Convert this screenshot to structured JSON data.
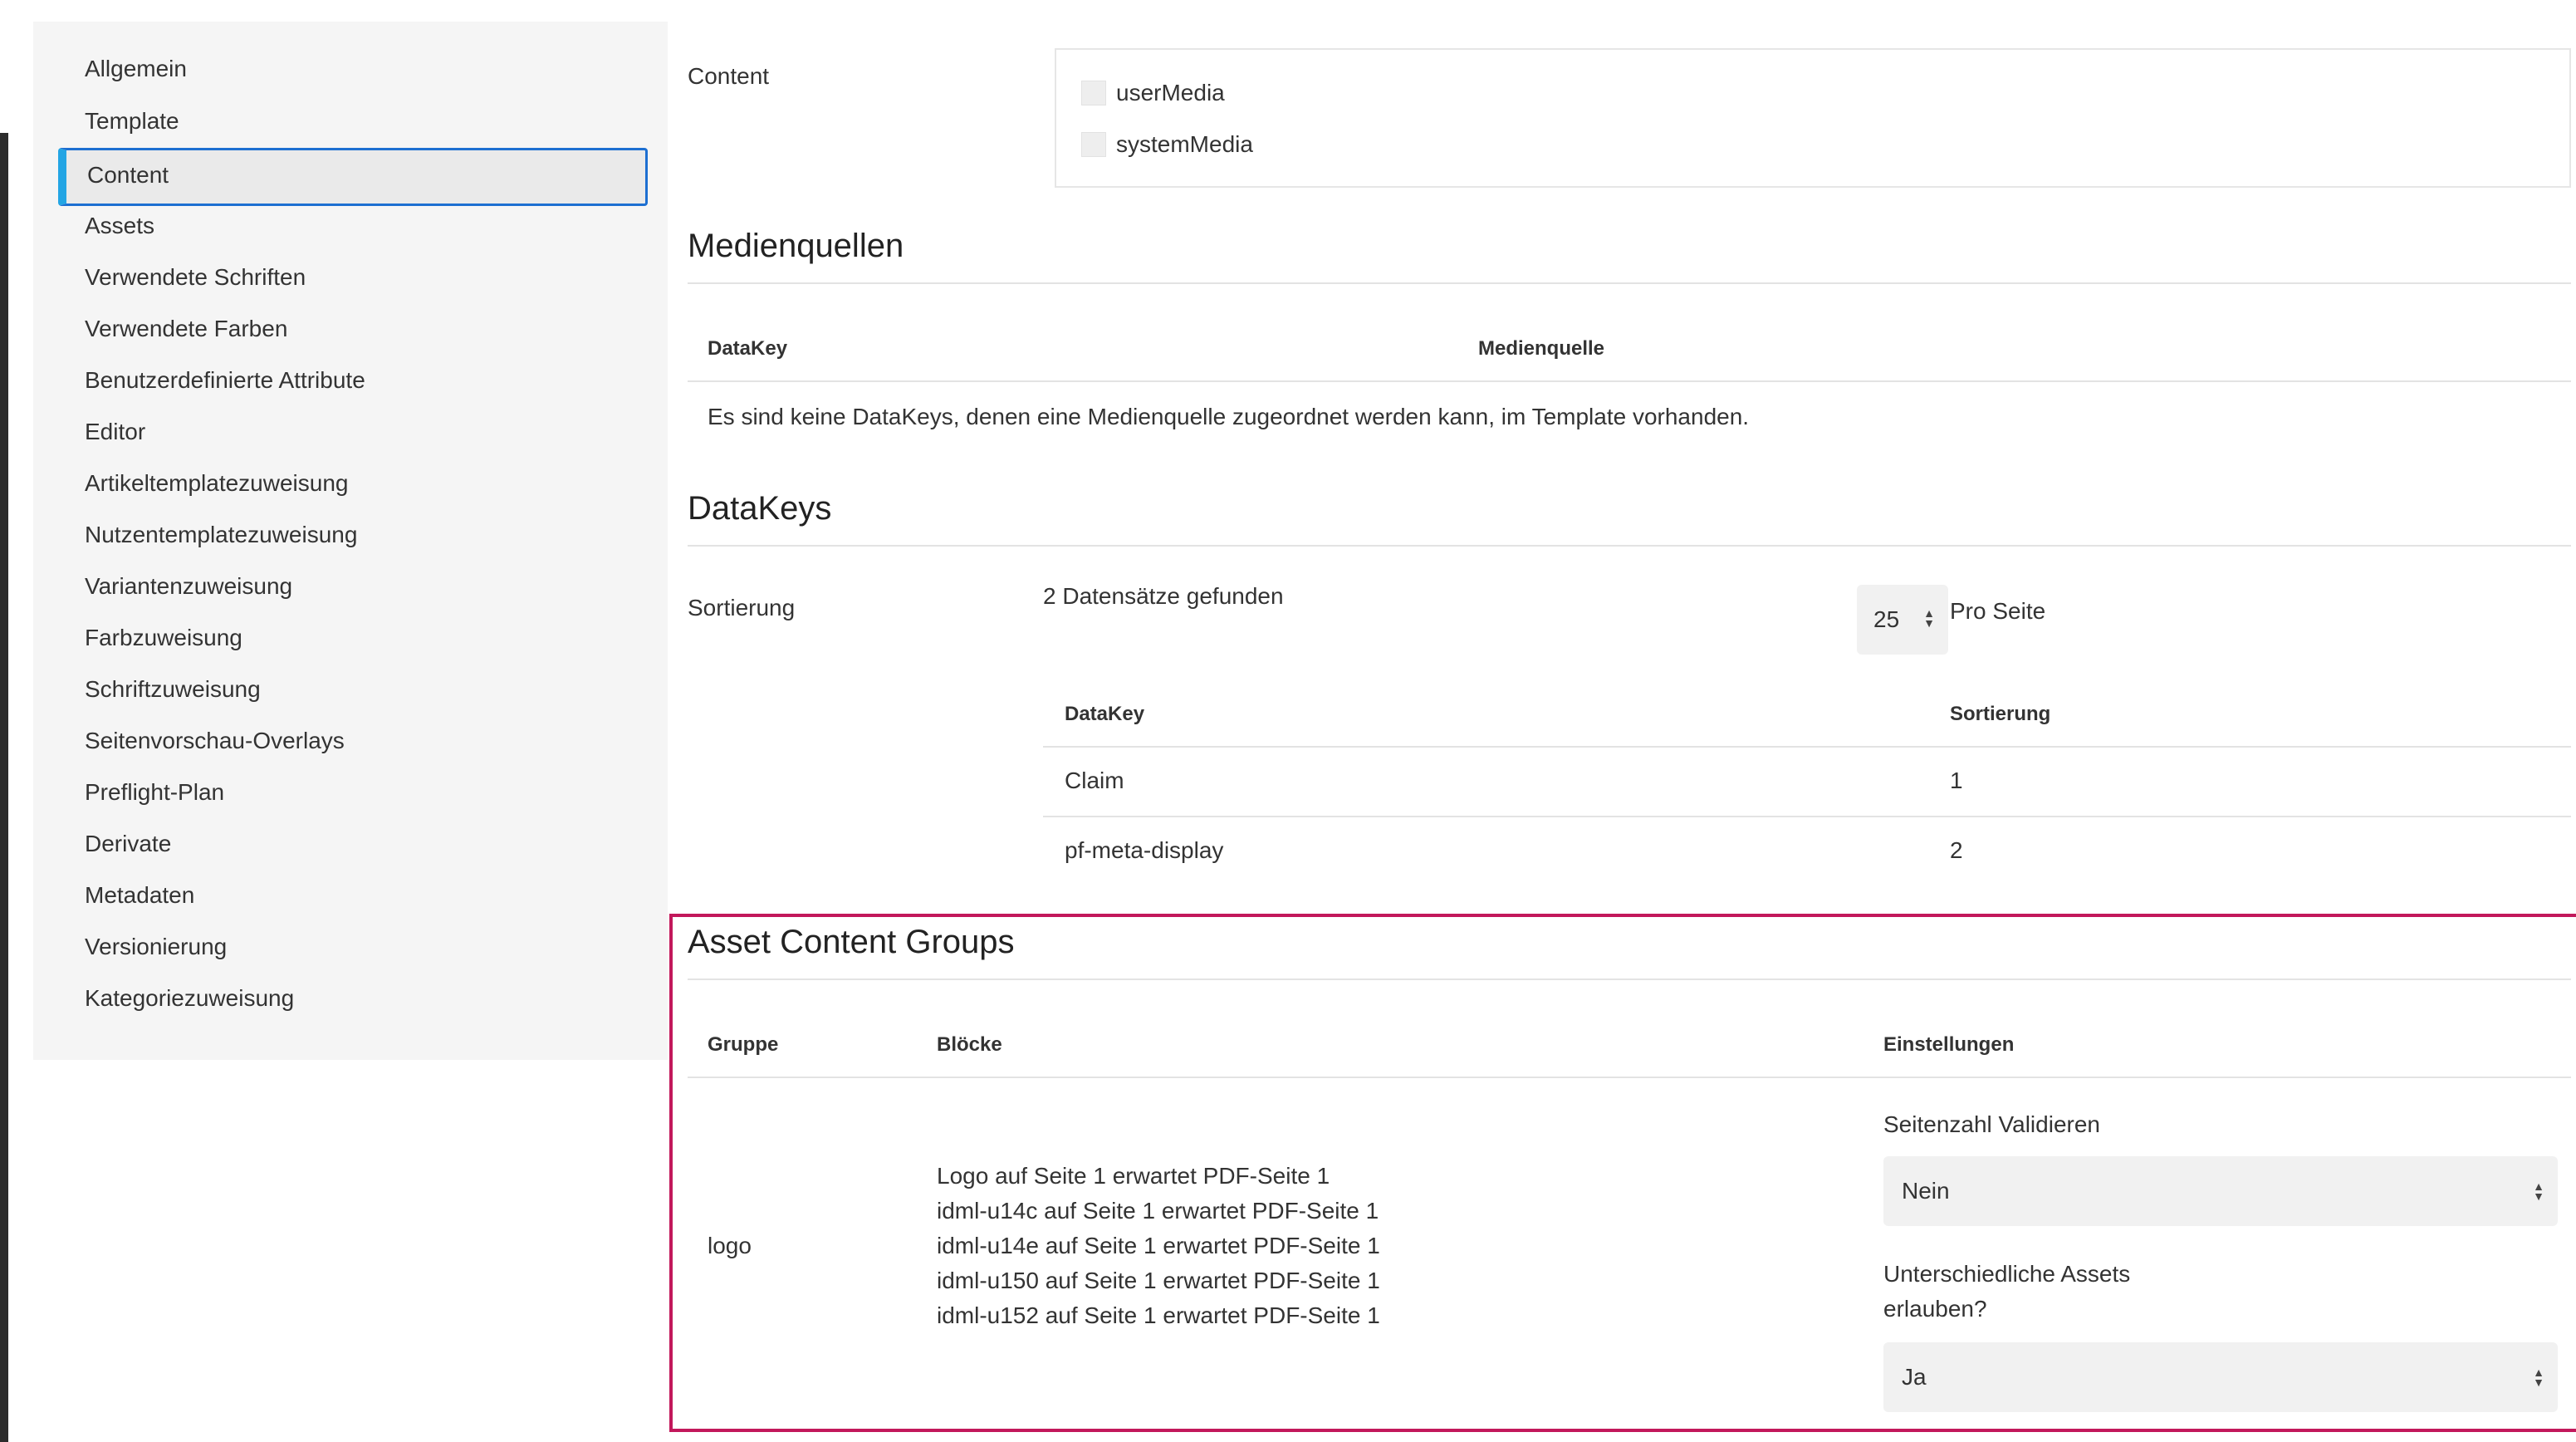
{
  "sidebar": {
    "items": [
      {
        "label": "Allgemein"
      },
      {
        "label": "Template"
      },
      {
        "label": "Content",
        "active": true
      },
      {
        "label": "Assets"
      },
      {
        "label": "Verwendete Schriften"
      },
      {
        "label": "Verwendete Farben"
      },
      {
        "label": "Benutzerdefinierte Attribute"
      },
      {
        "label": "Editor"
      },
      {
        "label": "Artikeltemplatezuweisung"
      },
      {
        "label": "Nutzentemplatezuweisung"
      },
      {
        "label": "Variantenzuweisung"
      },
      {
        "label": "Farbzuweisung"
      },
      {
        "label": "Schriftzuweisung"
      },
      {
        "label": "Seitenvorschau-Overlays"
      },
      {
        "label": "Preflight-Plan"
      },
      {
        "label": "Derivate"
      },
      {
        "label": "Metadaten"
      },
      {
        "label": "Versionierung"
      },
      {
        "label": "Kategoriezuweisung"
      }
    ]
  },
  "content": {
    "label": "Content",
    "options": [
      {
        "label": "userMedia",
        "checked": false
      },
      {
        "label": "systemMedia",
        "checked": false
      }
    ]
  },
  "medienquellen": {
    "title": "Medienquellen",
    "columns": [
      "DataKey",
      "Medienquelle"
    ],
    "empty_text": "Es sind keine DataKeys, denen eine Medienquelle zugeordnet werden kann, im Template vorhanden."
  },
  "datakeys": {
    "title": "DataKeys",
    "sort_label": "Sortierung",
    "found_text": "2 Datensätze gefunden",
    "per_page_value": "25",
    "per_page_label": "Pro Seite",
    "columns": [
      "DataKey",
      "Sortierung"
    ],
    "rows": [
      {
        "key": "Claim",
        "sort": "1"
      },
      {
        "key": "pf-meta-display",
        "sort": "2"
      }
    ]
  },
  "asset_groups": {
    "title": "Asset Content Groups",
    "columns": [
      "Gruppe",
      "Blöcke",
      "Einstellungen"
    ],
    "row": {
      "group": "logo",
      "blocks": [
        "Logo auf Seite 1 erwartet PDF-Seite 1",
        "idml-u14c auf Seite 1 erwartet PDF-Seite 1",
        "idml-u14e auf Seite 1 erwartet PDF-Seite 1",
        "idml-u150 auf Seite 1 erwartet PDF-Seite 1",
        "idml-u152 auf Seite 1 erwartet PDF-Seite 1"
      ],
      "setting1_label": "Seitenzahl Validieren",
      "setting1_value": "Nein",
      "setting2_label_line1": "Unterschiedliche Assets",
      "setting2_label_line2": "erlauben?",
      "setting2_value": "Ja"
    }
  },
  "colors": {
    "active_accent": "#23a5e4",
    "active_border": "#1d6fd1",
    "highlight": "#c2185b"
  }
}
